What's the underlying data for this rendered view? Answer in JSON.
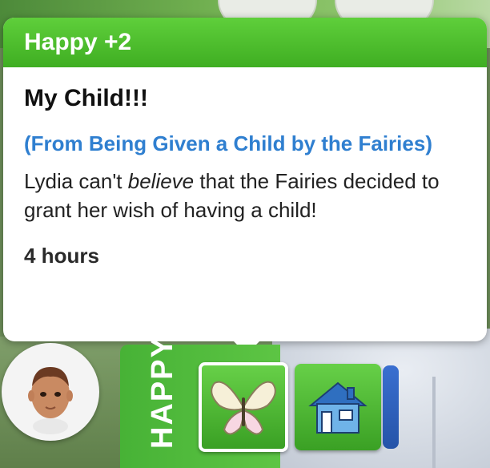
{
  "tooltip": {
    "header": "Happy +2",
    "title": "My Child!!!",
    "source": "(From Being Given a Child by the Fairies)",
    "description_start": "Lydia can't ",
    "description_emphasis": "believe",
    "description_end": " that the Fairies decided to grant her wish of having a child!",
    "duration": "4 hours"
  },
  "mood_panel": {
    "label": "HAPPY",
    "moodlets": [
      {
        "icon": "butterfly-icon",
        "selected": true
      },
      {
        "icon": "house-icon",
        "selected": false
      }
    ]
  },
  "colors": {
    "header_green": "#4cbf2c",
    "source_blue": "#2f7fd0",
    "side_bar_blue": "#2553a8"
  }
}
